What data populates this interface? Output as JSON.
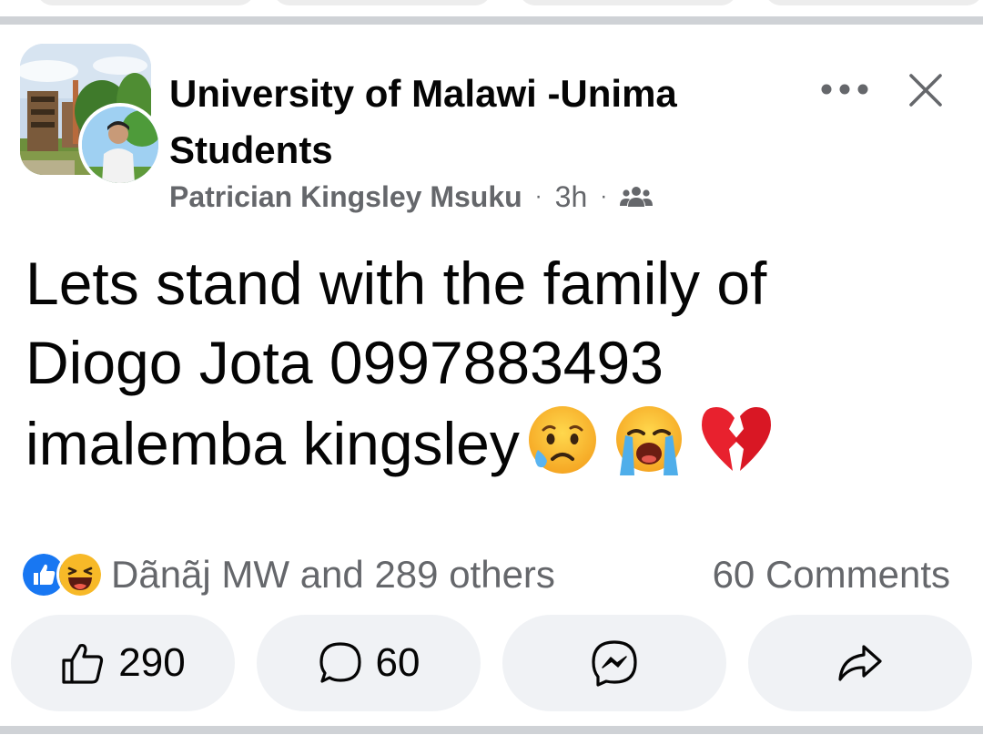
{
  "header": {
    "group_name": "University of Malawi -Unima Students",
    "author": "Patrician Kingsley Msuku",
    "time": "3h",
    "separator": "·",
    "audience_icon": "group-members-icon",
    "more_icon": "more-options-icon",
    "close_icon": "close-icon"
  },
  "post": {
    "text_line1": "Lets stand with the family of",
    "text_line2": "Diogo Jota 0997883493",
    "text_line3": "imalemba kingsley",
    "emojis": [
      "sad-tear-emoji",
      "loudly-crying-emoji",
      "broken-heart-emoji"
    ]
  },
  "reactions": {
    "types": [
      "like",
      "haha"
    ],
    "summary": "Dãnãj MW and 289 others",
    "comments": "60 Comments"
  },
  "actions": {
    "like_count": "290",
    "comment_count": "60",
    "send_icon": "messenger-icon",
    "share_icon": "share-icon"
  },
  "colors": {
    "text_primary": "#050505",
    "text_secondary": "#65676b",
    "button_bg": "#f0f2f5",
    "like_blue": "#1877f2",
    "divider": "#cfd2d6"
  }
}
